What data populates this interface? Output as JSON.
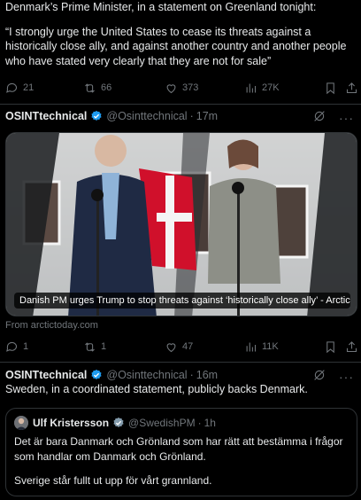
{
  "tweet1": {
    "line1": "Denmark’s Prime Minister, in a statement on Greenland tonight:",
    "quote": "“I strongly urge the United States to cease its threats against a historically close ally, and against another country and another people who have stated very clearly that they are not for sale”",
    "replies": "21",
    "retweets": "66",
    "likes": "373",
    "views": "27K"
  },
  "tweet2": {
    "name": "OSINTtechnical",
    "handle": "@Osinttechnical",
    "time": "17m",
    "card_title": "Danish PM urges Trump to stop threats against ‘historically close ally’ - ArcticT...",
    "card_source": "From arctictoday.com",
    "replies": "1",
    "retweets": "1",
    "likes": "47",
    "views": "11K"
  },
  "tweet3": {
    "name": "OSINTtechnical",
    "handle": "@Osinttechnical",
    "time": "16m",
    "text": "Sweden, in a coordinated statement, publicly backs Denmark.",
    "quoted": {
      "name": "Ulf Kristersson",
      "handle": "@SwedishPM",
      "time": "1h",
      "para1": "Det är bara Danmark och Grönland som har rätt att bestämma i frågor som handlar om Danmark och Grönland.",
      "para2": "Sverige står fullt ut upp för vårt grannland."
    }
  },
  "colors": {
    "background": "#000000",
    "text": "#e7e9ea",
    "muted": "#71767b",
    "verified": "#1d9bf0",
    "divider": "#2f3336"
  },
  "icons": [
    "reply-icon",
    "retweet-icon",
    "like-icon",
    "views-icon",
    "bookmark-icon",
    "share-icon",
    "grok-icon",
    "more-icon",
    "verified-icon"
  ]
}
